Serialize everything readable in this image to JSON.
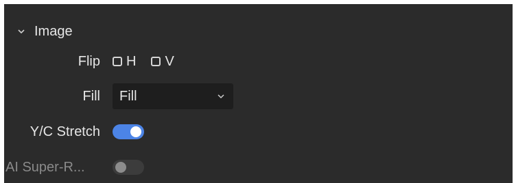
{
  "section": {
    "title": "Image",
    "expanded": true
  },
  "flip": {
    "label": "Flip",
    "h_label": "H",
    "v_label": "V",
    "h_checked": false,
    "v_checked": false
  },
  "fill": {
    "label": "Fill",
    "selected": "Fill"
  },
  "yc_stretch": {
    "label": "Y/C Stretch",
    "enabled": true
  },
  "ai_super_res": {
    "label": "AI Super-R...",
    "enabled": false,
    "disabled": true
  },
  "colors": {
    "panel_bg": "#2b2b2b",
    "accent": "#4c84e6",
    "text": "#e6e6e6",
    "text_dim": "#8a8a8a"
  }
}
